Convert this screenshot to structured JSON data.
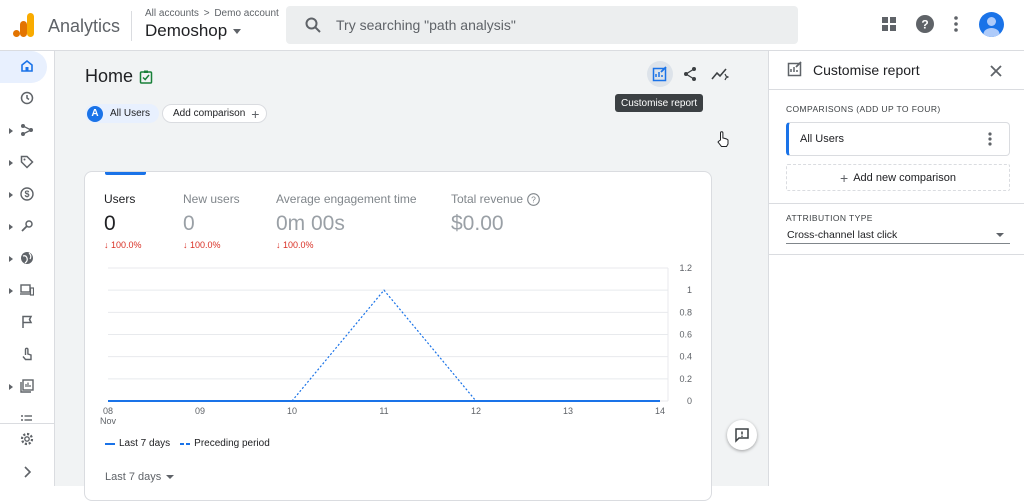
{
  "app": {
    "name": "Analytics"
  },
  "header": {
    "breadcrumb": [
      "All accounts",
      "Demo account"
    ],
    "breadcrumb_sep": ">",
    "property": "Demoshop",
    "search_placeholder": "Try searching \"path analysis\""
  },
  "icons": {
    "logo": "analytics-logo-icon",
    "search": "search-icon",
    "apps": "apps-grid-icon",
    "help": "help-icon",
    "more": "more-vert-icon",
    "account": "account-avatar-icon"
  },
  "nav": {
    "items": [
      {
        "icon": "home-icon",
        "active": true
      },
      {
        "icon": "realtime-clock-icon"
      },
      {
        "icon": "user-journey-icon"
      },
      {
        "icon": "acquisition-tag-icon"
      },
      {
        "icon": "monetization-dollar-icon"
      },
      {
        "icon": "engagement-icon"
      },
      {
        "icon": "globe-icon"
      },
      {
        "icon": "devices-icon"
      },
      {
        "icon": "flag-icon"
      },
      {
        "icon": "touch-icon"
      },
      {
        "icon": "library-icon"
      },
      {
        "icon": "list-icon"
      }
    ],
    "settings_icon": "settings-gear-icon",
    "collapse_icon": "chevron-right-icon"
  },
  "page": {
    "title": "Home",
    "comparison_chip": {
      "badge": "A",
      "label": "All Users"
    },
    "add_comparison": "Add comparison",
    "tooltip": "Customise report"
  },
  "metrics": [
    {
      "label": "Users",
      "value": "0",
      "change": "↓ 100.0%"
    },
    {
      "label": "New users",
      "value": "0",
      "change": "↓ 100.0%"
    },
    {
      "label": "Average engagement time",
      "value": "0m 00s",
      "change": "↓ 100.0%"
    },
    {
      "label": "Total revenue",
      "value": "$0.00",
      "change": ""
    }
  ],
  "chart_data": {
    "type": "line",
    "x": [
      "08 Nov",
      "09",
      "10",
      "11",
      "12",
      "13",
      "14"
    ],
    "yticks": [
      "0",
      "0.2",
      "0.4",
      "0.6",
      "0.8",
      "1",
      "1.2"
    ],
    "ylim": [
      0,
      1.2
    ],
    "series": [
      {
        "name": "Last 7 days",
        "values": [
          0,
          0,
          0,
          0,
          0,
          0,
          0
        ],
        "color": "#1a73e8",
        "style": "solid"
      },
      {
        "name": "Preceding period",
        "values": [
          0,
          0,
          0,
          1,
          0,
          0,
          0
        ],
        "color": "#1a73e8",
        "style": "dotted"
      }
    ],
    "grid": true,
    "legend_position": "bottom-left"
  },
  "date_range": "Last 7 days",
  "panel": {
    "title": "Customise report",
    "comparisons_label": "COMPARISONS (ADD UP TO FOUR)",
    "comparison": "All Users",
    "add_new": "Add new comparison",
    "attribution_label": "ATTRIBUTION TYPE",
    "attribution_value": "Cross-channel last click"
  }
}
